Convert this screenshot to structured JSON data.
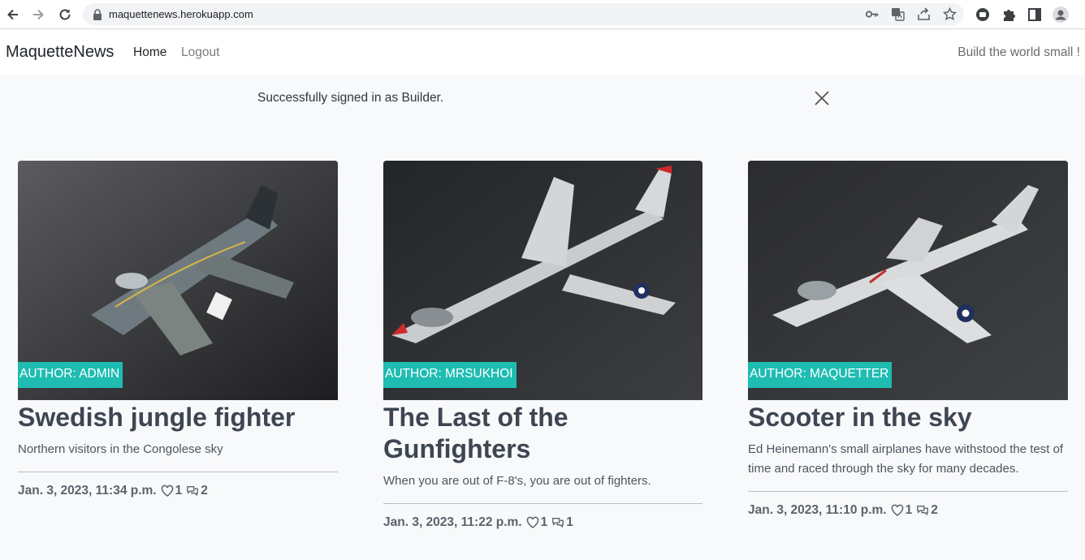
{
  "browser": {
    "url": "maquettenews.herokuapp.com"
  },
  "navbar": {
    "brand": "MaquetteNews",
    "links": [
      "Home",
      "Logout"
    ],
    "tagline": "Build the world small !"
  },
  "alert": {
    "message": "Successfully signed in as Builder."
  },
  "posts": [
    {
      "author_badge": "AUTHOR: ADMIN",
      "title": "Swedish jungle fighter",
      "excerpt": "Northern visitors in the Congolese sky",
      "date": "Jan. 3, 2023, 11:34 p.m.",
      "likes": "1",
      "comments": "2"
    },
    {
      "author_badge": "AUTHOR: MRSUKHOI",
      "title": "The Last of the Gunfighters",
      "excerpt": "When you are out of F-8's, you are out of fighters.",
      "date": "Jan. 3, 2023, 11:22 p.m.",
      "likes": "1",
      "comments": "1"
    },
    {
      "author_badge": "AUTHOR: MAQUETTER",
      "title": "Scooter in the sky",
      "excerpt": "Ed Heinemann's small airplanes have withstood the test of time and raced through the sky for many decades.",
      "date": "Jan. 3, 2023, 11:10 p.m.",
      "likes": "1",
      "comments": "2"
    }
  ],
  "colors": {
    "badge": "#1fbcb2",
    "page_bg": "#f8f9fa"
  }
}
